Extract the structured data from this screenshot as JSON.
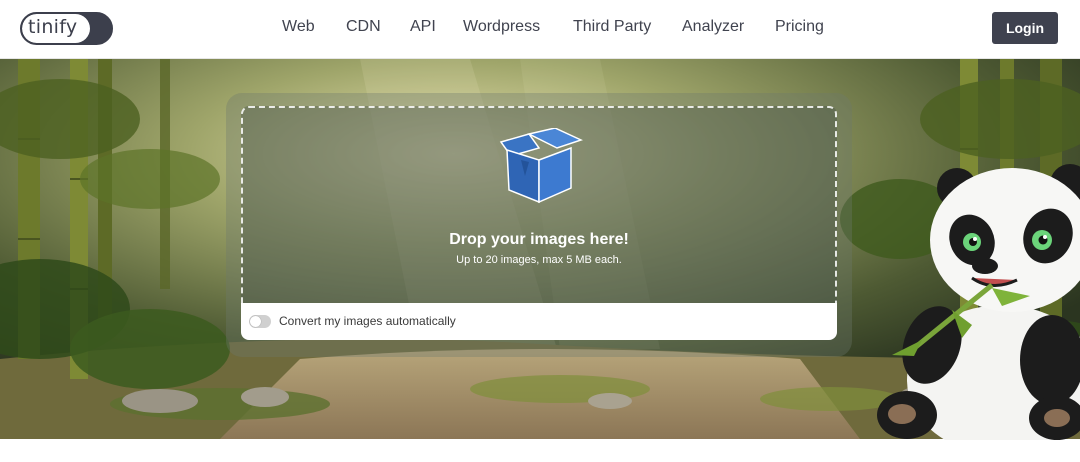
{
  "header": {
    "logo_text": "tinify",
    "nav": [
      {
        "label": "Web"
      },
      {
        "label": "CDN"
      },
      {
        "label": "API"
      },
      {
        "label": "Wordpress"
      },
      {
        "label": "Third Party"
      },
      {
        "label": "Analyzer"
      },
      {
        "label": "Pricing"
      }
    ],
    "login_label": "Login"
  },
  "dropzone": {
    "title": "Drop your images here!",
    "subtitle": "Up to 20 images, max 5 MB each.",
    "icon": "box-icon"
  },
  "convert": {
    "label": "Convert my images automatically",
    "enabled": false
  },
  "colors": {
    "header_text": "#40434f",
    "login_bg": "#3f424f",
    "box_blue": "#2f6fc7",
    "panel_overlay": "#6e786e"
  }
}
